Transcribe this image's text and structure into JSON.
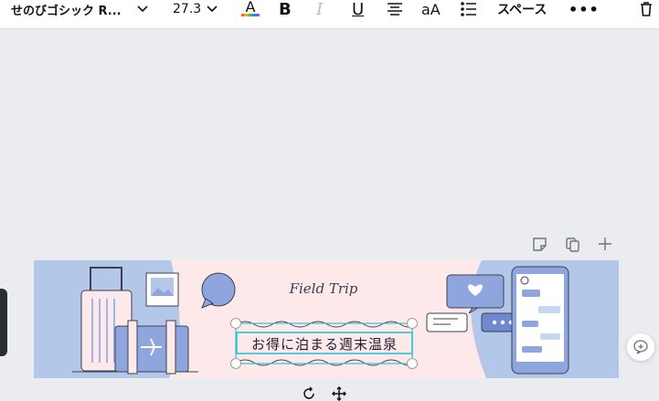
{
  "toolbar": {
    "font_name": "せのびゴシック R...",
    "font_size": "27.3",
    "text_color_letter": "A",
    "bold": "B",
    "italic": "I",
    "underline": "U",
    "case": "aA",
    "spacing": "スペース",
    "more": "•••"
  },
  "design": {
    "script_text": "Field Trip",
    "headline": "お得に泊まる週末温泉",
    "colors": {
      "banner_blue": "#b3c7e9",
      "center_pink": "#fde8ea",
      "accent_blue": "#8ea6dd",
      "selection": "#26c6d4"
    }
  },
  "icons": {
    "font_dropdown": "chevron-down-icon",
    "size_dropdown": "chevron-down-icon",
    "align": "align-center-icon",
    "list": "bulleted-list-icon",
    "trash": "trash-icon",
    "note": "sticky-note-icon",
    "duplicate": "duplicate-page-icon",
    "add": "plus-icon",
    "comment": "add-comment-icon",
    "rotate": "rotate-icon",
    "move": "move-icon"
  }
}
